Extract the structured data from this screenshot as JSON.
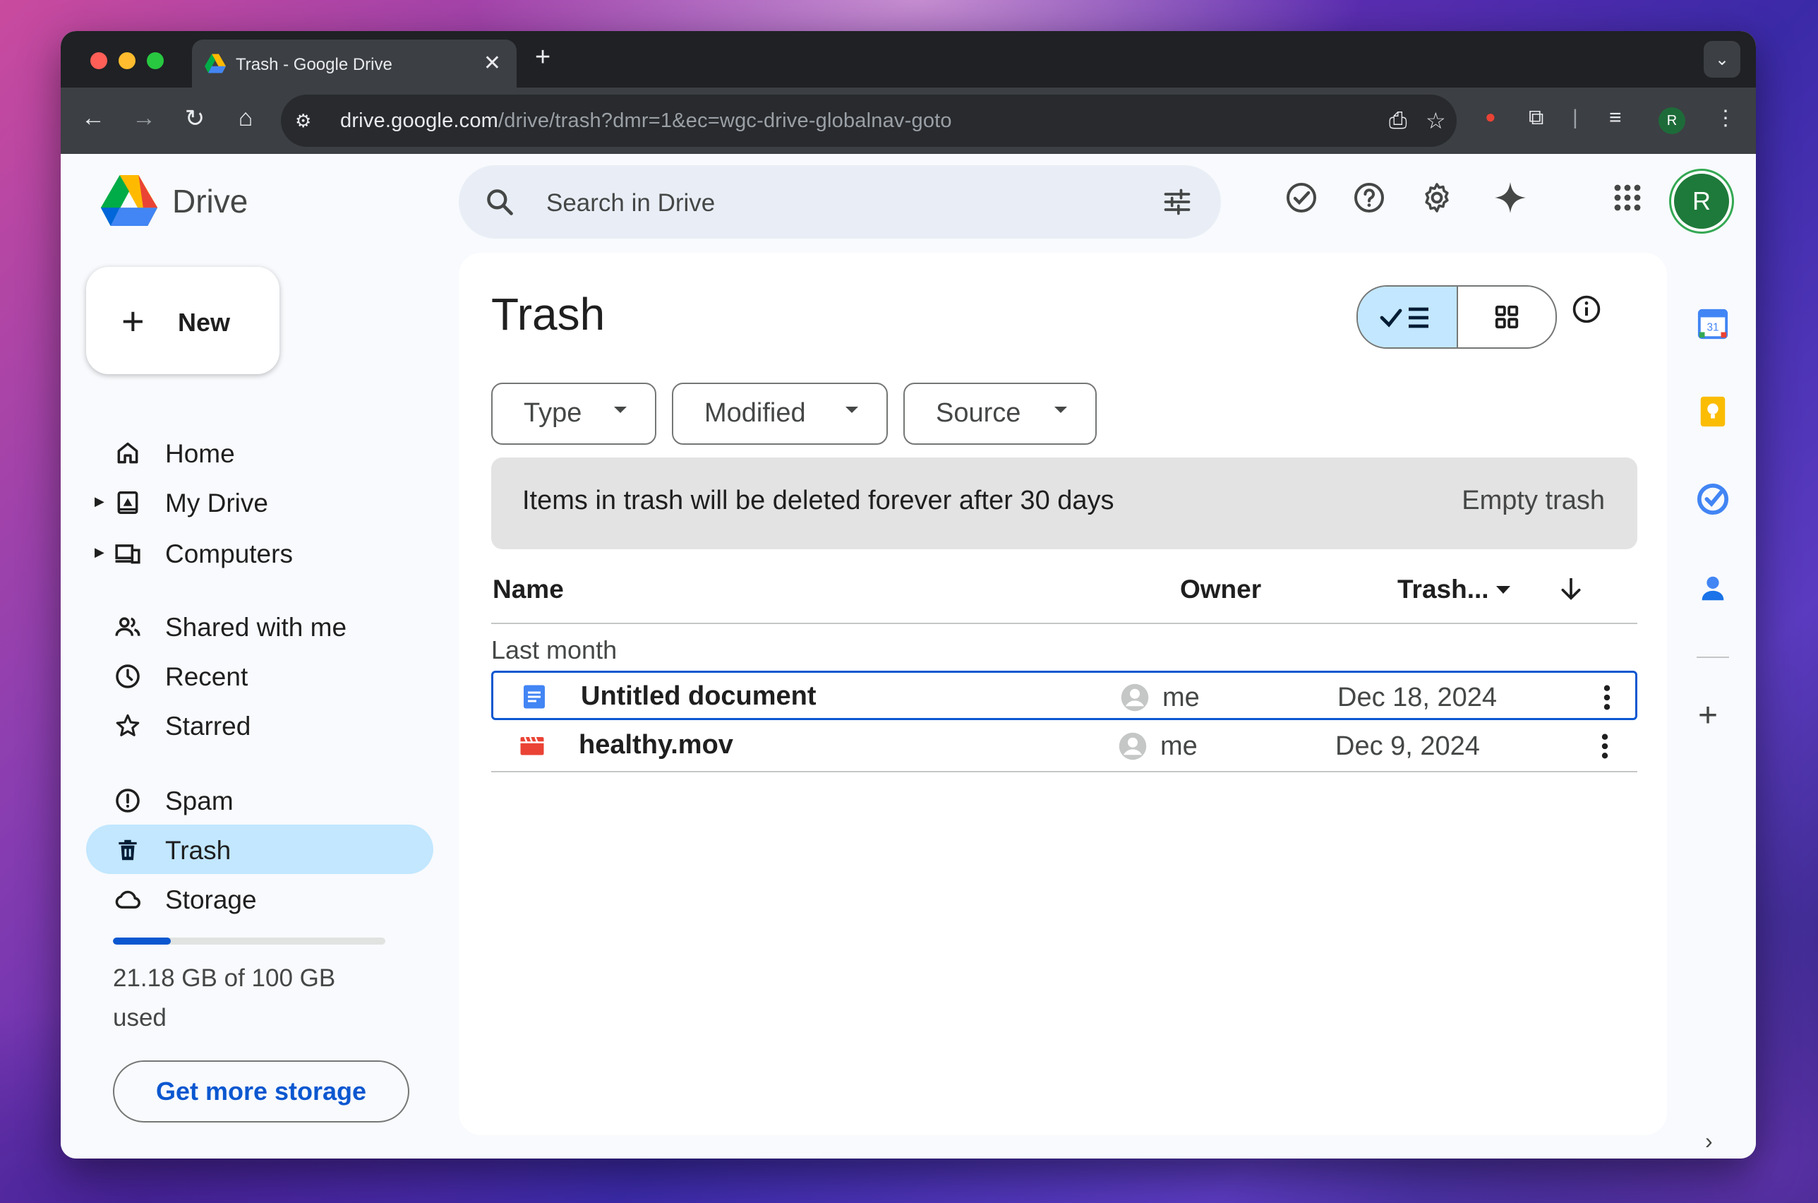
{
  "browser": {
    "tab_title": "Trash - Google Drive",
    "tab_close": "✕",
    "new_tab": "+",
    "tab_menu": "⌄",
    "url_host": "drive.google.com",
    "url_path": "/drive/trash?dmr=1&ec=wgc-drive-globalnav-goto",
    "profile_initial": "R"
  },
  "app": {
    "brand": "Drive",
    "search_placeholder": "Search in Drive",
    "avatar_initial": "R",
    "new_label": "New"
  },
  "sidebar": {
    "items": [
      {
        "label": "Home",
        "icon": "home-icon"
      },
      {
        "label": "My Drive",
        "icon": "my-drive-icon"
      },
      {
        "label": "Computers",
        "icon": "computers-icon"
      },
      {
        "label": "Shared with me",
        "icon": "shared-icon"
      },
      {
        "label": "Recent",
        "icon": "clock-icon"
      },
      {
        "label": "Starred",
        "icon": "star-icon"
      },
      {
        "label": "Spam",
        "icon": "spam-icon"
      },
      {
        "label": "Trash",
        "icon": "trash-icon"
      },
      {
        "label": "Storage",
        "icon": "cloud-icon"
      }
    ],
    "storage_text": "21.18 GB of 100 GB used",
    "storage_used_fraction": 0.2118,
    "get_more_storage": "Get more storage"
  },
  "main": {
    "title": "Trash",
    "filters": [
      "Type",
      "Modified",
      "Source"
    ],
    "banner_text": "Items in trash will be deleted forever after 30 days",
    "empty_trash": "Empty trash",
    "columns": {
      "name": "Name",
      "owner": "Owner",
      "trashed": "Trash..."
    },
    "group_label": "Last month",
    "rows": [
      {
        "name": "Untitled document",
        "owner": "me",
        "date": "Dec 18, 2024",
        "type": "doc"
      },
      {
        "name": "healthy.mov",
        "owner": "me",
        "date": "Dec 9, 2024",
        "type": "video"
      }
    ]
  },
  "colors": {
    "accent": "#0b57d0",
    "active_nav": "#c2e7ff",
    "doc_blue": "#4285f4",
    "video_red": "#ea4335"
  }
}
